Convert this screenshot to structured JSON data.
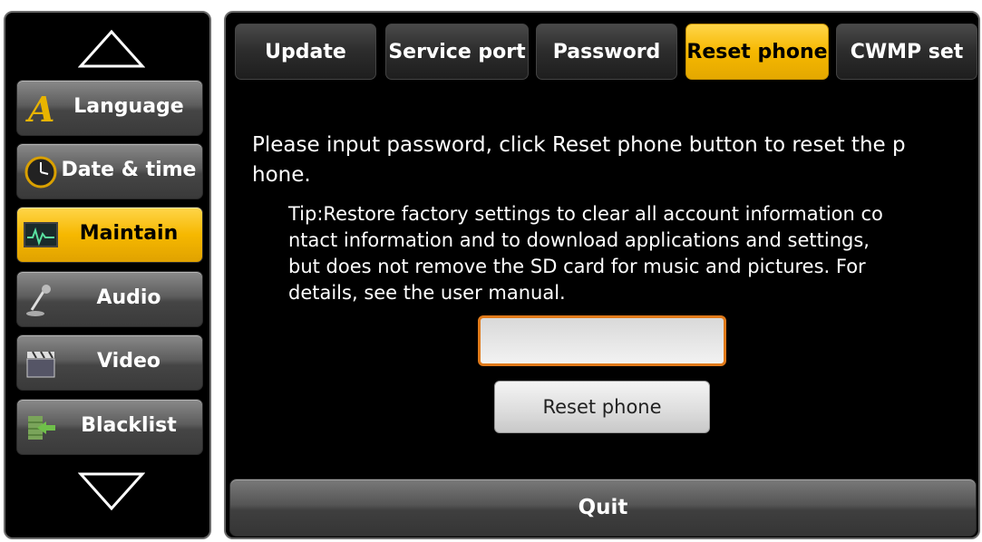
{
  "sidebar": {
    "items": [
      {
        "label": "Language",
        "icon": "letter-a-icon"
      },
      {
        "label": "Date & time",
        "icon": "clock-icon"
      },
      {
        "label": "Maintain",
        "icon": "monitor-pulse-icon",
        "active": true
      },
      {
        "label": "Audio",
        "icon": "microphone-icon"
      },
      {
        "label": "Video",
        "icon": "clapperboard-icon"
      },
      {
        "label": "Blacklist",
        "icon": "blocked-wall-icon"
      }
    ]
  },
  "tabs": [
    {
      "label": "Update"
    },
    {
      "label": "Service port"
    },
    {
      "label": "Password"
    },
    {
      "label": "Reset phone",
      "active": true
    },
    {
      "label": "CWMP set"
    }
  ],
  "main": {
    "message": "Please input password, click Reset phone button to reset the p\nhone.",
    "tip": "Tip:Restore factory settings to clear all account information co\nntact information and to download applications and settings,\nbut does not remove the SD card for music and pictures. For\ndetails, see the user manual.",
    "password_value": "",
    "reset_button_label": "Reset phone",
    "quit_label": "Quit"
  },
  "colors": {
    "accent_active": "#f6b800",
    "input_border": "#e07a1a",
    "background": "#000000"
  }
}
